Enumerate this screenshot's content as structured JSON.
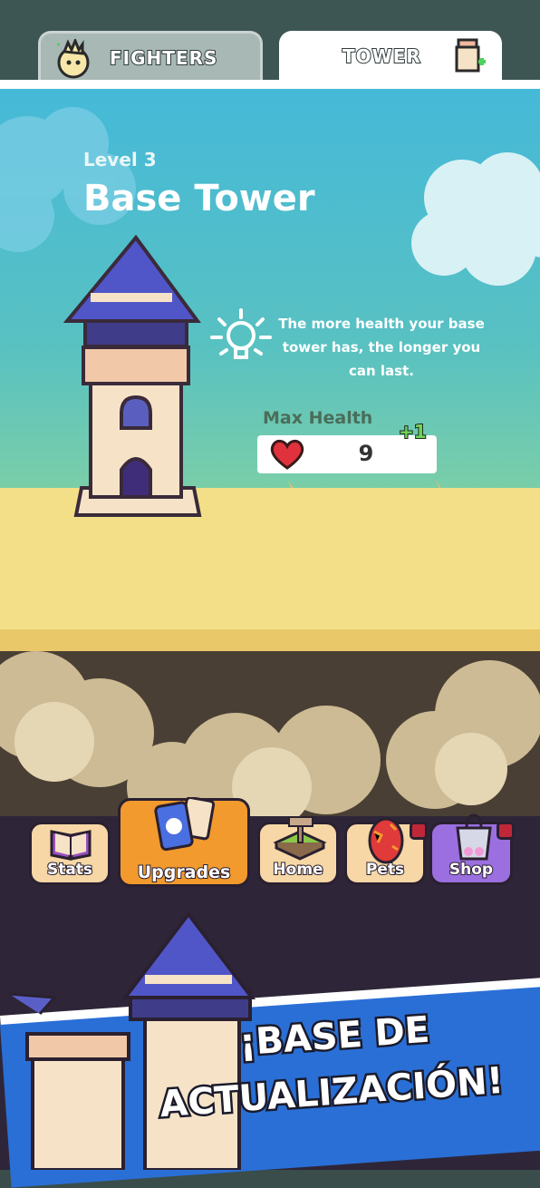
{
  "tabs": {
    "fighters_label": "FIGHTERS",
    "tower_label": "TOWER",
    "active": "TOWER"
  },
  "tower": {
    "level_text": "Level 3",
    "title": "Base Tower",
    "tip": "The more health your base tower has, the longer you can last.",
    "stat_label": "Max Health",
    "stat_value": "9",
    "stat_bonus": "+1"
  },
  "nav": {
    "items": [
      {
        "label": "Stats",
        "icon": "book-icon"
      },
      {
        "label": "Upgrades",
        "icon": "cards-icon",
        "active": true
      },
      {
        "label": "Home",
        "icon": "signpost-icon"
      },
      {
        "label": "Pets",
        "icon": "egg-icon",
        "badge": true
      },
      {
        "label": "Shop",
        "icon": "shopping-bag-icon",
        "badge": true
      }
    ]
  },
  "promo": {
    "line1": "¡BASE DE",
    "line2": "ACTUALIZACIÓN!"
  },
  "colors": {
    "sky": "#45b9d8",
    "ground": "#f3df88",
    "nav_bg": "#2e2638",
    "active_tab": "#ffffff",
    "upgrades_active": "#f29a2e",
    "heart": "#e0323c",
    "bonus_green": "#6fd45a",
    "promo_blue": "#2a6fd6"
  }
}
